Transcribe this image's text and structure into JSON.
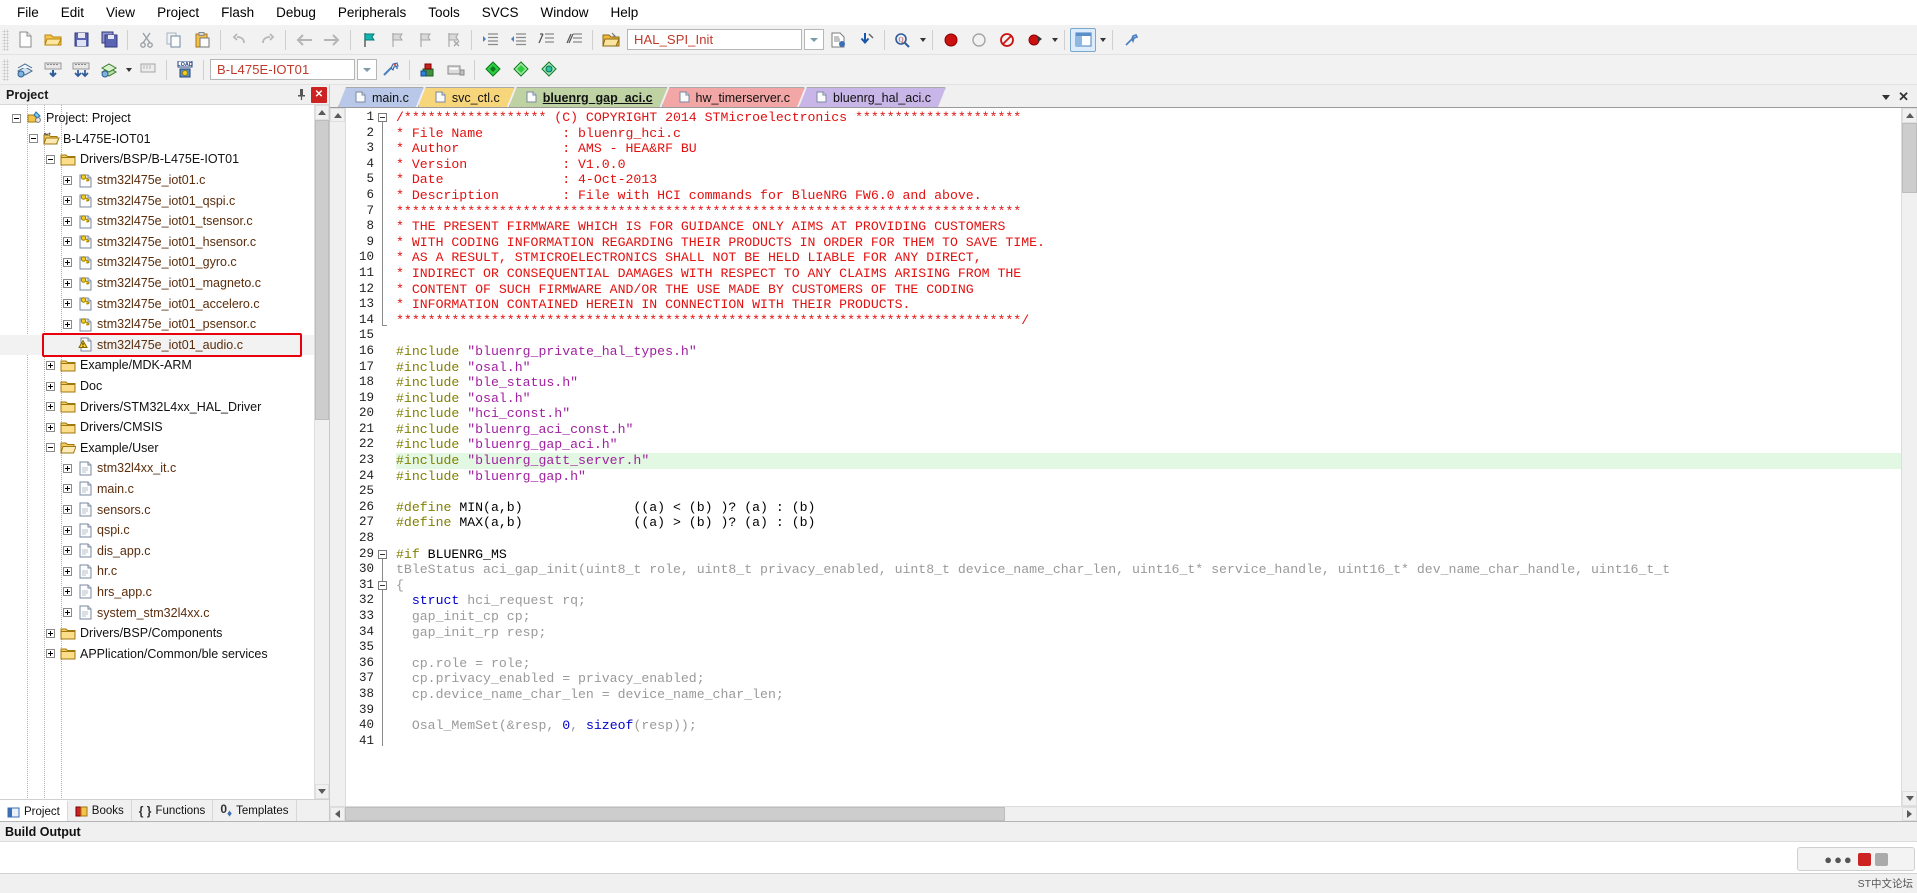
{
  "menubar": {
    "items": [
      "File",
      "Edit",
      "View",
      "Project",
      "Flash",
      "Debug",
      "Peripherals",
      "Tools",
      "SVCS",
      "Window",
      "Help"
    ]
  },
  "toolbar1": {
    "icons": [
      "new-file-icon",
      "open-file-icon",
      "save-icon",
      "save-all-icon",
      "cut-icon",
      "copy-icon",
      "paste-icon",
      "undo-icon",
      "redo-icon",
      "navigate-back-icon",
      "navigate-forward-icon",
      "bookmark-toggle-icon",
      "bookmark-prev-icon",
      "bookmark-next-icon",
      "bookmark-clear-icon",
      "indent-right-icon",
      "indent-left-icon",
      "comment-icon",
      "uncomment-icon",
      "open-file-folder-icon"
    ],
    "combo_value": "HAL_SPI_Init",
    "after_combo_icons": [
      "insert-file-icon",
      "incremental-find-icon",
      "find-in-files-icon",
      "debug-stop-icon",
      "breakpoint-icon",
      "disable-breakpoints-icon",
      "kill-breakpoints-icon",
      "window-layout-icon",
      "configure-icon"
    ]
  },
  "toolbar2": {
    "icons": [
      "translate-icon",
      "build-icon",
      "rebuild-all-icon",
      "batch-build-icon",
      "batch-build-dropdown",
      "stop-build-icon",
      "load-icon"
    ],
    "target_value": "B-L475E-IOT01",
    "after_icons": [
      "target-options-icon",
      "manage-run-env-icon",
      "package-installer-icon",
      "multi-project-icon",
      "book-icon",
      "function-icon",
      "template-icon"
    ]
  },
  "project_pane": {
    "title": "Project",
    "pin_icon": "pin-icon",
    "close_icon": "close-icon",
    "tree": [
      {
        "label": "Project: Project",
        "depth": 0,
        "expander": "minus",
        "icon": "project-icon",
        "color": "dark"
      },
      {
        "label": "B-L475E-IOT01",
        "depth": 1,
        "expander": "minus",
        "icon": "target-folder-icon",
        "color": "dark"
      },
      {
        "label": "Drivers/BSP/B-L475E-IOT01",
        "depth": 2,
        "expander": "minus",
        "icon": "folder-icon",
        "color": "dark"
      },
      {
        "label": "stm32l475e_iot01.c",
        "depth": 3,
        "expander": "plus",
        "icon": "source-key-icon",
        "color": "brown"
      },
      {
        "label": "stm32l475e_iot01_qspi.c",
        "depth": 3,
        "expander": "plus",
        "icon": "source-key-icon",
        "color": "brown"
      },
      {
        "label": "stm32l475e_iot01_tsensor.c",
        "depth": 3,
        "expander": "plus",
        "icon": "source-key-icon",
        "color": "brown"
      },
      {
        "label": "stm32l475e_iot01_hsensor.c",
        "depth": 3,
        "expander": "plus",
        "icon": "source-key-icon",
        "color": "brown"
      },
      {
        "label": "stm32l475e_iot01_gyro.c",
        "depth": 3,
        "expander": "plus",
        "icon": "source-key-icon",
        "color": "brown"
      },
      {
        "label": "stm32l475e_iot01_magneto.c",
        "depth": 3,
        "expander": "plus",
        "icon": "source-key-icon",
        "color": "brown"
      },
      {
        "label": "stm32l475e_iot01_accelero.c",
        "depth": 3,
        "expander": "plus",
        "icon": "source-key-icon",
        "color": "brown"
      },
      {
        "label": "stm32l475e_iot01_psensor.c",
        "depth": 3,
        "expander": "plus",
        "icon": "source-key-icon",
        "color": "brown"
      },
      {
        "label": "stm32l475e_iot01_audio.c",
        "depth": 3,
        "expander": "none",
        "icon": "warning-file-icon",
        "color": "brown",
        "selected": true,
        "annotated": true
      },
      {
        "label": "Example/MDK-ARM",
        "depth": 2,
        "expander": "plus",
        "icon": "folder-icon",
        "color": "dark"
      },
      {
        "label": "Doc",
        "depth": 2,
        "expander": "plus",
        "icon": "folder-icon",
        "color": "dark"
      },
      {
        "label": "Drivers/STM32L4xx_HAL_Driver",
        "depth": 2,
        "expander": "plus",
        "icon": "folder-icon",
        "color": "dark"
      },
      {
        "label": "Drivers/CMSIS",
        "depth": 2,
        "expander": "plus",
        "icon": "folder-icon",
        "color": "dark"
      },
      {
        "label": "Example/User",
        "depth": 2,
        "expander": "minus",
        "icon": "folder-open-icon",
        "color": "dark"
      },
      {
        "label": "stm32l4xx_it.c",
        "depth": 3,
        "expander": "plus",
        "icon": "source-file-icon",
        "color": "brown"
      },
      {
        "label": "main.c",
        "depth": 3,
        "expander": "plus",
        "icon": "source-file-icon",
        "color": "brown"
      },
      {
        "label": "sensors.c",
        "depth": 3,
        "expander": "plus",
        "icon": "source-file-icon",
        "color": "brown"
      },
      {
        "label": "qspi.c",
        "depth": 3,
        "expander": "plus",
        "icon": "source-file-icon",
        "color": "brown"
      },
      {
        "label": "dis_app.c",
        "depth": 3,
        "expander": "plus",
        "icon": "source-file-icon",
        "color": "brown"
      },
      {
        "label": "hr.c",
        "depth": 3,
        "expander": "plus",
        "icon": "source-file-icon",
        "color": "brown"
      },
      {
        "label": "hrs_app.c",
        "depth": 3,
        "expander": "plus",
        "icon": "source-file-icon",
        "color": "brown"
      },
      {
        "label": "system_stm32l4xx.c",
        "depth": 3,
        "expander": "plus",
        "icon": "source-file-icon",
        "color": "brown"
      },
      {
        "label": "Drivers/BSP/Components",
        "depth": 2,
        "expander": "plus",
        "icon": "folder-icon",
        "color": "dark"
      },
      {
        "label": "APPlication/Common/ble services",
        "depth": 2,
        "expander": "plus",
        "icon": "folder-icon",
        "color": "dark"
      }
    ],
    "bottom_tabs": [
      {
        "label": "Project",
        "icon": "project-tab-icon",
        "active": true
      },
      {
        "label": "Books",
        "icon": "books-icon",
        "active": false
      },
      {
        "label": "Functions",
        "icon": "functions-braces-icon",
        "active": false
      },
      {
        "label": "Templates",
        "icon": "templates-icon",
        "active": false
      }
    ]
  },
  "editor": {
    "tabs": [
      {
        "label": "main.c",
        "color": "#b9c8e8",
        "active": false
      },
      {
        "label": "svc_ctl.c",
        "color": "#f7d57a",
        "active": false
      },
      {
        "label": "bluenrg_gap_aci.c",
        "color": "#bed2a4",
        "active": true
      },
      {
        "label": "hw_timerserver.c",
        "color": "#f2a6a6",
        "active": false
      },
      {
        "label": "bluenrg_hal_aci.c",
        "color": "#c9b6e8",
        "active": false
      }
    ],
    "tabstrip_right": [
      "chevron-down-icon",
      "close-icon"
    ],
    "first_line": 1,
    "lines": [
      {
        "n": 1,
        "fold": "start",
        "spans": [
          {
            "t": "/****************** (C) COPYRIGHT 2014 STMicroelectronics *********************",
            "c": "cmt"
          }
        ]
      },
      {
        "n": 2,
        "spans": [
          {
            "t": "* File Name          : bluenrg_hci.c",
            "c": "cmt"
          }
        ]
      },
      {
        "n": 3,
        "spans": [
          {
            "t": "* Author             : AMS - HEA&RF BU",
            "c": "cmt"
          }
        ]
      },
      {
        "n": 4,
        "spans": [
          {
            "t": "* Version            : V1.0.0",
            "c": "cmt"
          }
        ]
      },
      {
        "n": 5,
        "spans": [
          {
            "t": "* Date               : 4-Oct-2013",
            "c": "cmt"
          }
        ]
      },
      {
        "n": 6,
        "spans": [
          {
            "t": "* Description        : File with HCI commands for BlueNRG FW6.0 and above.",
            "c": "cmt"
          }
        ]
      },
      {
        "n": 7,
        "spans": [
          {
            "t": "*******************************************************************************",
            "c": "cmt"
          }
        ]
      },
      {
        "n": 8,
        "spans": [
          {
            "t": "* THE PRESENT FIRMWARE WHICH IS FOR GUIDANCE ONLY AIMS AT PROVIDING CUSTOMERS",
            "c": "cmt"
          }
        ]
      },
      {
        "n": 9,
        "spans": [
          {
            "t": "* WITH CODING INFORMATION REGARDING THEIR PRODUCTS IN ORDER FOR THEM TO SAVE TIME.",
            "c": "cmt"
          }
        ]
      },
      {
        "n": 10,
        "spans": [
          {
            "t": "* AS A RESULT, STMICROELECTRONICS SHALL NOT BE HELD LIABLE FOR ANY DIRECT,",
            "c": "cmt"
          }
        ]
      },
      {
        "n": 11,
        "spans": [
          {
            "t": "* INDIRECT OR CONSEQUENTIAL DAMAGES WITH RESPECT TO ANY CLAIMS ARISING FROM THE",
            "c": "cmt"
          }
        ]
      },
      {
        "n": 12,
        "spans": [
          {
            "t": "* CONTENT OF SUCH FIRMWARE AND/OR THE USE MADE BY CUSTOMERS OF THE CODING",
            "c": "cmt"
          }
        ]
      },
      {
        "n": 13,
        "spans": [
          {
            "t": "* INFORMATION CONTAINED HEREIN IN CONNECTION WITH THEIR PRODUCTS.",
            "c": "cmt"
          }
        ]
      },
      {
        "n": 14,
        "fold": "end",
        "spans": [
          {
            "t": "*******************************************************************************/",
            "c": "cmt"
          }
        ]
      },
      {
        "n": 15,
        "spans": [
          {
            "t": "",
            "c": "blk"
          }
        ]
      },
      {
        "n": 16,
        "spans": [
          {
            "t": "#include ",
            "c": "pre"
          },
          {
            "t": "\"bluenrg_private_hal_types.h\"",
            "c": "str"
          }
        ]
      },
      {
        "n": 17,
        "spans": [
          {
            "t": "#include ",
            "c": "pre"
          },
          {
            "t": "\"osal.h\"",
            "c": "str"
          }
        ]
      },
      {
        "n": 18,
        "spans": [
          {
            "t": "#include ",
            "c": "pre"
          },
          {
            "t": "\"ble_status.h\"",
            "c": "str"
          }
        ]
      },
      {
        "n": 19,
        "spans": [
          {
            "t": "#include ",
            "c": "pre"
          },
          {
            "t": "\"osal.h\"",
            "c": "str"
          }
        ]
      },
      {
        "n": 20,
        "spans": [
          {
            "t": "#include ",
            "c": "pre"
          },
          {
            "t": "\"hci_const.h\"",
            "c": "str"
          }
        ]
      },
      {
        "n": 21,
        "spans": [
          {
            "t": "#include ",
            "c": "pre"
          },
          {
            "t": "\"bluenrg_aci_const.h\"",
            "c": "str"
          }
        ]
      },
      {
        "n": 22,
        "spans": [
          {
            "t": "#include ",
            "c": "pre"
          },
          {
            "t": "\"bluenrg_gap_aci.h\"",
            "c": "str"
          }
        ]
      },
      {
        "n": 23,
        "highlight": true,
        "spans": [
          {
            "t": "#include ",
            "c": "pre"
          },
          {
            "t": "\"bluenrg_gatt_server.h\"",
            "c": "str"
          }
        ]
      },
      {
        "n": 24,
        "spans": [
          {
            "t": "#include ",
            "c": "pre"
          },
          {
            "t": "\"bluenrg_gap.h\"",
            "c": "str"
          }
        ]
      },
      {
        "n": 25,
        "spans": [
          {
            "t": "",
            "c": "blk"
          }
        ]
      },
      {
        "n": 26,
        "spans": [
          {
            "t": "#define ",
            "c": "pre"
          },
          {
            "t": "MIN(a,b)              ((a) < (b) )? (a) : (b)",
            "c": "blk"
          }
        ]
      },
      {
        "n": 27,
        "spans": [
          {
            "t": "#define ",
            "c": "pre"
          },
          {
            "t": "MAX(a,b)              ((a) > (b) )? (a) : (b)",
            "c": "blk"
          }
        ]
      },
      {
        "n": 28,
        "spans": [
          {
            "t": "",
            "c": "blk"
          }
        ]
      },
      {
        "n": 29,
        "fold": "start",
        "spans": [
          {
            "t": "#if ",
            "c": "pre"
          },
          {
            "t": "BLUENRG_MS",
            "c": "blk"
          }
        ]
      },
      {
        "n": 30,
        "spans": [
          {
            "t": "tBleStatus aci_gap_init(uint8_t role, uint8_t privacy_enabled, uint8_t device_name_char_len, uint16_t* service_handle, uint16_t* dev_name_char_handle, uint16_t_t",
            "c": "gray"
          }
        ]
      },
      {
        "n": 31,
        "fold": "start",
        "spans": [
          {
            "t": "{",
            "c": "gray"
          }
        ]
      },
      {
        "n": 32,
        "spans": [
          {
            "t": "  ",
            "c": "gray"
          },
          {
            "t": "struct",
            "c": "kw"
          },
          {
            "t": " hci_request rq;",
            "c": "gray"
          }
        ]
      },
      {
        "n": 33,
        "spans": [
          {
            "t": "  gap_init_cp cp;",
            "c": "gray"
          }
        ]
      },
      {
        "n": 34,
        "spans": [
          {
            "t": "  gap_init_rp resp;",
            "c": "gray"
          }
        ]
      },
      {
        "n": 35,
        "spans": [
          {
            "t": "",
            "c": "gray"
          }
        ]
      },
      {
        "n": 36,
        "spans": [
          {
            "t": "  cp.role = role;",
            "c": "gray"
          }
        ]
      },
      {
        "n": 37,
        "spans": [
          {
            "t": "  cp.privacy_enabled = privacy_enabled;",
            "c": "gray"
          }
        ]
      },
      {
        "n": 38,
        "spans": [
          {
            "t": "  cp.device_name_char_len = device_name_char_len;",
            "c": "gray"
          }
        ]
      },
      {
        "n": 39,
        "spans": [
          {
            "t": "",
            "c": "gray"
          }
        ]
      },
      {
        "n": 40,
        "spans": [
          {
            "t": "  Osal_MemSet(&resp, ",
            "c": "gray"
          },
          {
            "t": "0",
            "c": "kw"
          },
          {
            "t": ", ",
            "c": "gray"
          },
          {
            "t": "sizeof",
            "c": "kw"
          },
          {
            "t": "(resp));",
            "c": "gray"
          }
        ]
      },
      {
        "n": 41,
        "spans": [
          {
            "t": "",
            "c": "gray"
          }
        ]
      }
    ]
  },
  "build_output": {
    "title": "Build Output",
    "content": ""
  },
  "statusbar": {
    "text": ""
  },
  "ime": {
    "label": "ST中文论坛"
  },
  "colors": {
    "comment": "#e31010",
    "preprocessor": "#808000",
    "string": "#a020a0",
    "keyword": "#0000cc",
    "inactive": "#9a9a9a",
    "highlight_row": "#e3f8e3",
    "annotation": "#e8000d",
    "tree_label": "#5a2d0c"
  }
}
